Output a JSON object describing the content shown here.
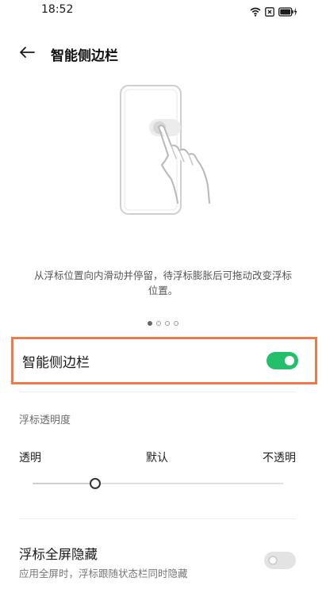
{
  "status_bar": {
    "time": "18:52"
  },
  "header": {
    "title": "智能侧边栏",
    "back_icon": "arrow-left-icon"
  },
  "illustration": {
    "icon": "phone-swipe-gesture-illustration"
  },
  "description": "从浮标位置向内滑动并停留，待浮标膨胀后可拖动改变浮标位置。",
  "pager": {
    "count": 4,
    "active_index": 0
  },
  "smart_sidebar": {
    "label": "智能侧边栏",
    "enabled": true
  },
  "opacity": {
    "section_label": "浮标透明度",
    "left_label": "透明",
    "middle_label": "默认",
    "right_label": "不透明",
    "value_fraction": 0.25
  },
  "fullscreen_hide": {
    "title": "浮标全屏隐藏",
    "subtitle": "应用全屏时，浮标跟随状态栏同时隐藏",
    "enabled": false
  },
  "colors": {
    "accent": "#22c06b",
    "highlight_border": "#ee7a4a"
  }
}
